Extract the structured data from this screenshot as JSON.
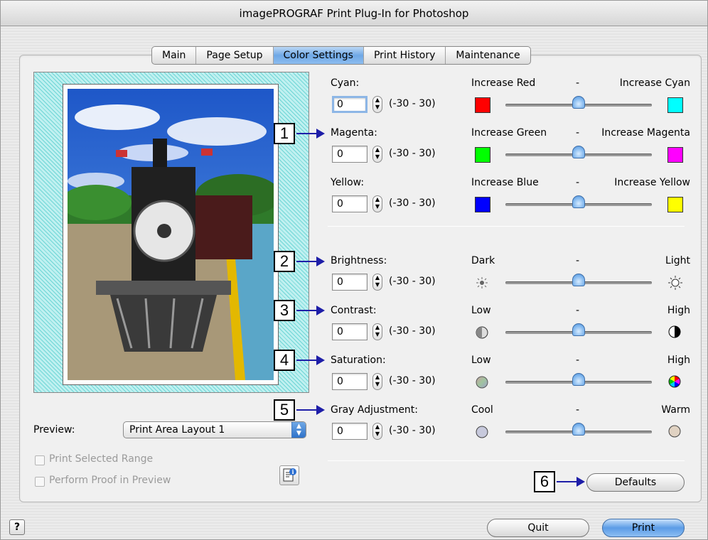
{
  "window": {
    "title": "imagePROGRAF Print Plug-In for Photoshop"
  },
  "tabs": [
    "Main",
    "Page Setup",
    "Color Settings",
    "Print History",
    "Maintenance"
  ],
  "active_tab": "Color Settings",
  "preview": {
    "label": "Preview:",
    "select_value": "Print Area Layout 1",
    "print_selected_range": "Print Selected Range",
    "perform_proof": "Perform Proof in Preview"
  },
  "range_text": "(-30 - 30)",
  "center_mark": "-",
  "adjustments": [
    {
      "label": "Cyan:",
      "value": "0",
      "left": "Increase Red",
      "right": "Increase Cyan",
      "left_color": "#ff0000",
      "right_color": "#00ffff",
      "level": 0
    },
    {
      "label": "Magenta:",
      "value": "0",
      "left": "Increase Green",
      "right": "Increase Magenta",
      "left_color": "#00ff00",
      "right_color": "#ff00ff",
      "level": 0
    },
    {
      "label": "Yellow:",
      "value": "0",
      "left": "Increase Blue",
      "right": "Increase Yellow",
      "left_color": "#0000ff",
      "right_color": "#ffff00",
      "level": 0
    },
    {
      "label": "Brightness:",
      "value": "0",
      "left": "Dark",
      "right": "Light",
      "left_icon": "dim-sun-icon",
      "right_icon": "bright-sun-icon",
      "level": 0
    },
    {
      "label": "Contrast:",
      "value": "0",
      "left": "Low",
      "right": "High",
      "left_icon": "low-contrast-icon",
      "right_icon": "high-contrast-icon",
      "level": 0
    },
    {
      "label": "Saturation:",
      "value": "0",
      "left": "Low",
      "right": "High",
      "left_icon": "low-saturation-icon",
      "right_icon": "high-saturation-icon",
      "level": 0
    },
    {
      "label": "Gray Adjustment:",
      "value": "0",
      "left": "Cool",
      "right": "Warm",
      "left_icon": "cool-tone-icon",
      "right_icon": "warm-tone-icon",
      "level": 0
    }
  ],
  "callouts": [
    "1",
    "2",
    "3",
    "4",
    "5",
    "6"
  ],
  "buttons": {
    "defaults": "Defaults",
    "quit": "Quit",
    "print": "Print"
  }
}
